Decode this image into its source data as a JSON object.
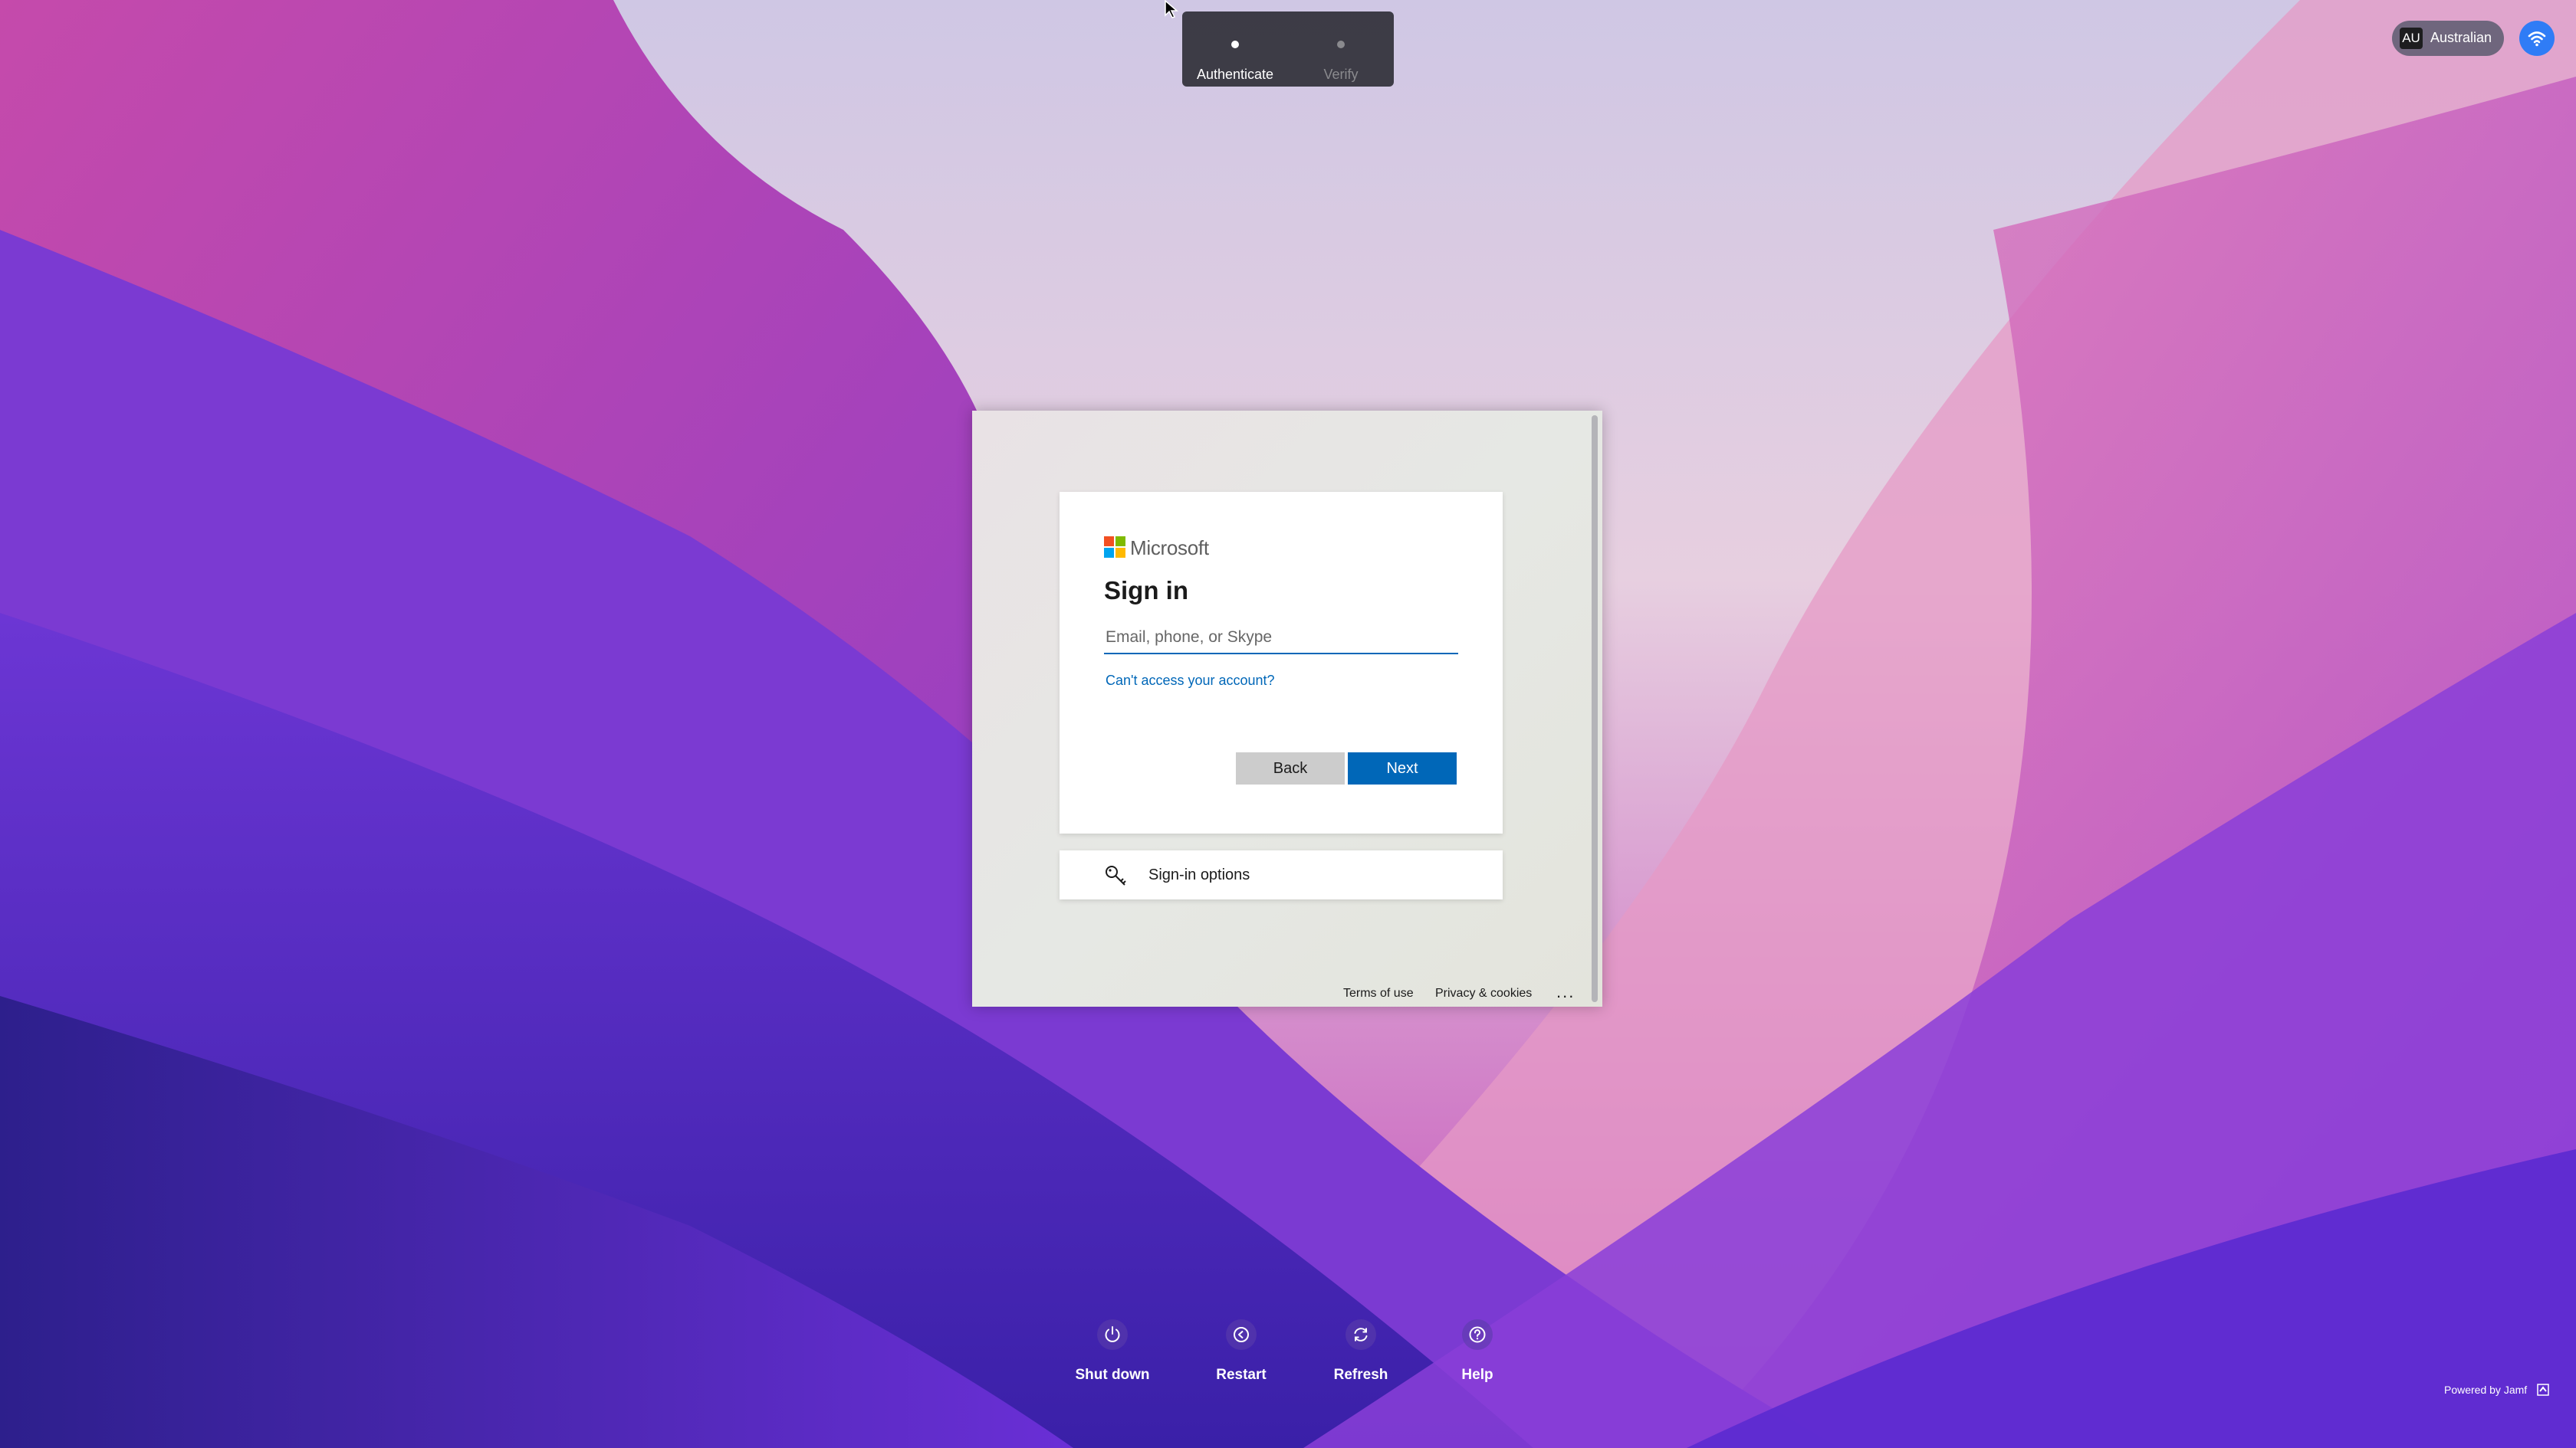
{
  "steps": [
    {
      "label": "Authenticate",
      "active": true
    },
    {
      "label": "Verify",
      "active": false
    }
  ],
  "top_right": {
    "language_code": "AU",
    "language_name": "Australian",
    "wifi_icon": "wifi-icon"
  },
  "signin": {
    "brand": "Microsoft",
    "title": "Sign in",
    "email_placeholder": "Email, phone, or Skype",
    "email_value": "",
    "cant_access": "Can't access your account?",
    "back_label": "Back",
    "next_label": "Next",
    "options_label": "Sign-in options",
    "terms": "Terms of use",
    "privacy": "Privacy & cookies",
    "more": "...",
    "colors": {
      "accent": "#0067b8",
      "logo": [
        "#f25022",
        "#7fba00",
        "#00a4ef",
        "#ffb900"
      ]
    }
  },
  "actions": [
    {
      "label": "Shut down",
      "icon": "power-icon"
    },
    {
      "label": "Restart",
      "icon": "restart-icon"
    },
    {
      "label": "Refresh",
      "icon": "refresh-icon"
    },
    {
      "label": "Help",
      "icon": "help-icon"
    }
  ],
  "footer": {
    "powered_by": "Powered by Jamf"
  }
}
